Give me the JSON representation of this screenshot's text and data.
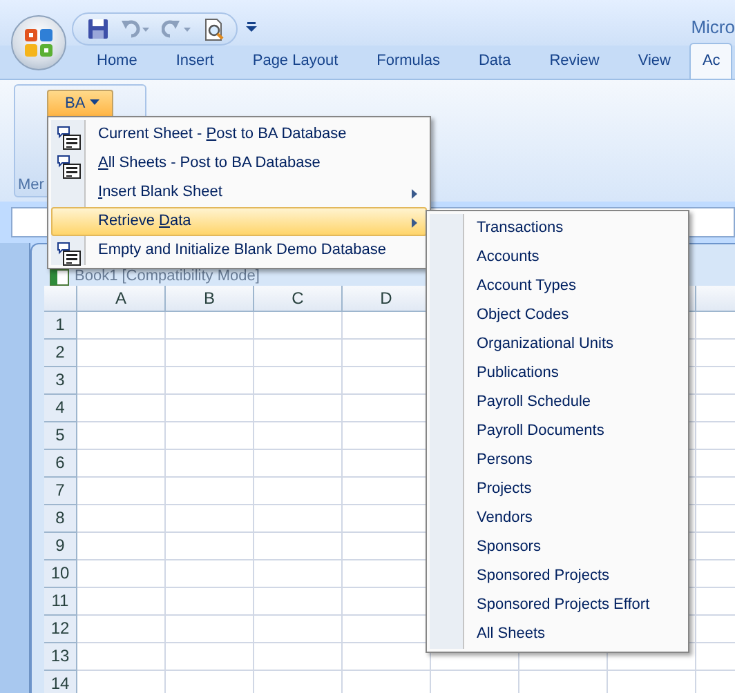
{
  "window": {
    "title": "Micro"
  },
  "ribbon_tabs": [
    {
      "label": "Home",
      "selected": false
    },
    {
      "label": "Insert",
      "selected": false
    },
    {
      "label": "Page Layout",
      "selected": false
    },
    {
      "label": "Formulas",
      "selected": false
    },
    {
      "label": "Data",
      "selected": false
    },
    {
      "label": "Review",
      "selected": false
    },
    {
      "label": "View",
      "selected": false
    },
    {
      "label": "Ac",
      "selected": true
    }
  ],
  "ribbon": {
    "button": {
      "label": "BA",
      "pressed": true
    },
    "group_label": "Mer"
  },
  "workbook": {
    "title": "Book1 [Compatibility Mode]",
    "columns": [
      "A",
      "B",
      "C",
      "D"
    ],
    "rows": [
      "1",
      "2",
      "3",
      "4",
      "5",
      "6",
      "7",
      "8",
      "9",
      "10",
      "11",
      "12",
      "13",
      "14"
    ]
  },
  "menu": [
    {
      "before": "Current Sheet - ",
      "key": "P",
      "after": "ost to BA Database",
      "icon": true,
      "submenu": false,
      "selected": false
    },
    {
      "key": "A",
      "after": "ll Sheets - Post to BA Database",
      "icon": true,
      "submenu": false,
      "selected": false
    },
    {
      "key": "I",
      "after": "nsert Blank Sheet",
      "icon": false,
      "submenu": true,
      "selected": false
    },
    {
      "before": "Retrieve ",
      "key": "D",
      "after": "ata",
      "icon": false,
      "submenu": true,
      "selected": true
    },
    {
      "before": "Empty and Initialize Blank Demo Database",
      "icon": true,
      "submenu": false,
      "selected": false
    }
  ],
  "submenu": [
    "Transactions",
    "Accounts",
    "Account Types",
    "Object Codes",
    "Organizational Units",
    "Publications",
    "Payroll Schedule",
    "Payroll Documents",
    "Persons",
    "Projects",
    "Vendors",
    "Sponsors",
    "Sponsored Projects",
    "Sponsored Projects Effort",
    "All Sheets"
  ]
}
